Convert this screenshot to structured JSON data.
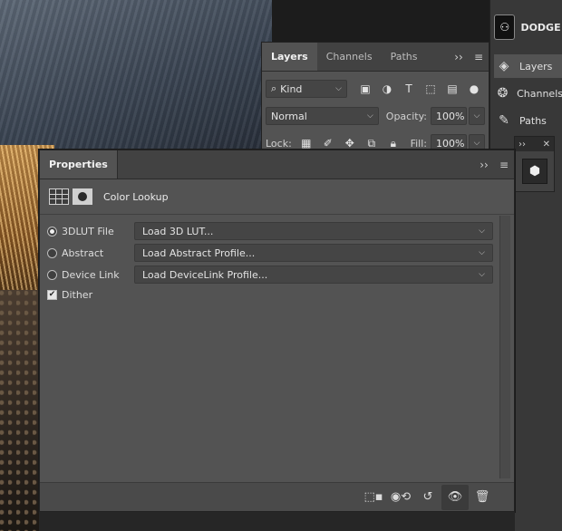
{
  "document": {
    "title": "DODGE A",
    "thumb_label": "Dodge"
  },
  "dock": {
    "items": [
      {
        "label": "Layers",
        "icon": "layers-icon"
      },
      {
        "label": "Channels",
        "icon": "channels-icon"
      },
      {
        "label": "Paths",
        "icon": "paths-icon"
      }
    ]
  },
  "mini_panel": {
    "expand": "››",
    "close": "✕"
  },
  "layers_panel": {
    "tabs": [
      "Layers",
      "Channels",
      "Paths"
    ],
    "expand": "››",
    "menu": "≡",
    "filter": {
      "value": "Kind"
    },
    "blend": {
      "value": "Normal"
    },
    "opacity": {
      "label": "Opacity:",
      "value": "100%"
    },
    "lock": {
      "label": "Lock:"
    },
    "fill": {
      "label": "Fill:",
      "value": "100%"
    }
  },
  "properties": {
    "tab": "Properties",
    "expand": "››",
    "menu": "≡",
    "title": "Color Lookup",
    "options": [
      {
        "label": "3DLUT File",
        "value": "Load 3D LUT...",
        "selected": true
      },
      {
        "label": "Abstract",
        "value": "Load Abstract Profile...",
        "selected": false
      },
      {
        "label": "Device Link",
        "value": "Load DeviceLink Profile...",
        "selected": false
      }
    ],
    "dither": {
      "label": "Dither",
      "checked": true
    }
  },
  "glyphs": {
    "chevron": "⌵"
  }
}
